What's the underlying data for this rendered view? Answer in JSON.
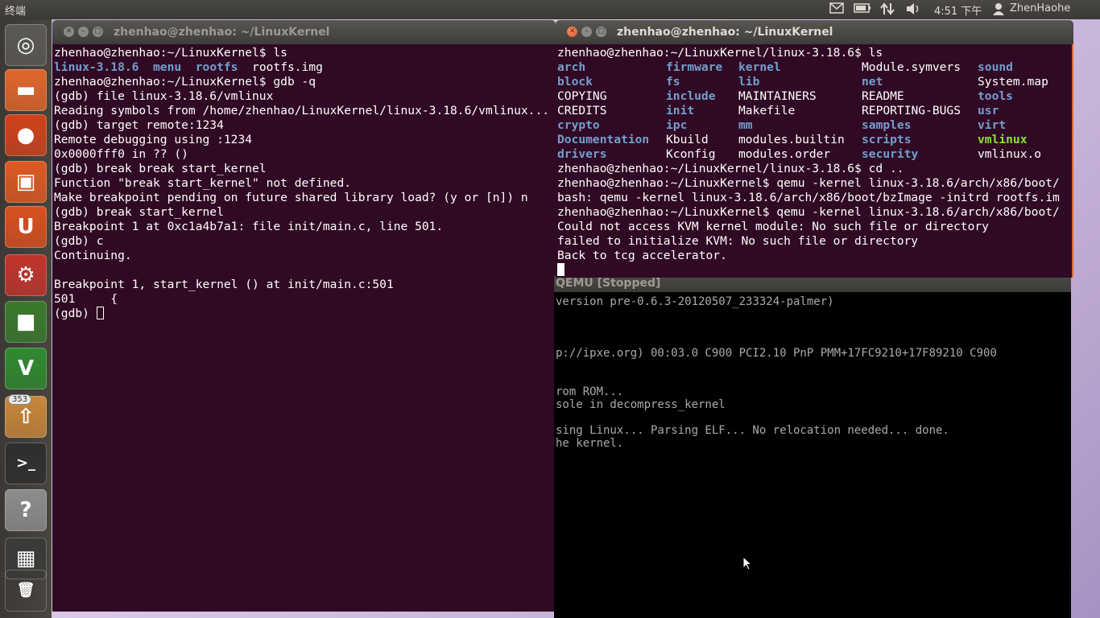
{
  "panel": {
    "app_title": "终端",
    "time": "4:51 下午",
    "user": "ZhenHaohe",
    "mail_icon": "mail-icon",
    "battery_icon": "battery-icon",
    "network_icon": "network-icon",
    "volume_icon": "volume-icon",
    "user_icon": "user-icon"
  },
  "launcher": {
    "items": [
      {
        "name": "dash-home",
        "icon": "ubuntu-logo-icon",
        "glyph": "◎",
        "color": "#5b5954"
      },
      {
        "name": "files",
        "icon": "folder-icon",
        "glyph": "▬",
        "color": "#e0662c"
      },
      {
        "name": "firefox",
        "icon": "firefox-icon",
        "glyph": "●",
        "color": "#d0421b"
      },
      {
        "name": "software-center",
        "icon": "shopping-bag-icon",
        "glyph": "▣",
        "color": "#dd5a22"
      },
      {
        "name": "ubuntu-one",
        "icon": "ubuntu-one-icon",
        "glyph": "U",
        "color": "#d9501e"
      },
      {
        "name": "system-settings",
        "icon": "settings-icon",
        "glyph": "⚙",
        "color": "#c2342c"
      },
      {
        "name": "workspaces",
        "icon": "workspaces-icon",
        "glyph": "■",
        "color": "#3a7a2c"
      },
      {
        "name": "vim",
        "icon": "vim-icon",
        "glyph": "V",
        "color": "#2f8a2f"
      },
      {
        "name": "update-manager",
        "icon": "update-icon",
        "glyph": "⇧",
        "color": "#c8873b"
      },
      {
        "name": "terminal",
        "icon": "terminal-icon",
        "glyph": ">_",
        "color": "#2e2e2e"
      },
      {
        "name": "help",
        "icon": "help-icon",
        "glyph": "?",
        "color": "#8d8d8d"
      },
      {
        "name": "workspace-switcher",
        "icon": "workspace-switcher-icon",
        "glyph": "▦",
        "color": "#3a3a38"
      },
      {
        "name": "trash",
        "icon": "trash-icon",
        "glyph": "🗑",
        "color": "#777"
      }
    ],
    "update_badge": "353"
  },
  "term_left": {
    "title": "zhenhao@zhenhao: ~/LinuxKernel",
    "lines": [
      "zhenhao@zhenhao:~/LinuxKernel$ ls",
      "",
      "zhenhao@zhenhao:~/LinuxKernel$ gdb -q",
      "(gdb) file linux-3.18.6/vmlinux",
      "Reading symbols from /home/zhenhao/LinuxKernel/linux-3.18.6/vmlinux...",
      "(gdb) target remote:1234",
      "Remote debugging using :1234",
      "0x0000fff0 in ?? ()",
      "(gdb) break break start_kernel",
      "Function \"break start_kernel\" not defined.",
      "Make breakpoint pending on future shared library load? (y or [n]) n",
      "(gdb) break start_kernel",
      "Breakpoint 1 at 0xc1a4b7a1: file init/main.c, line 501.",
      "(gdb) c",
      "Continuing.",
      "",
      "Breakpoint 1, start_kernel () at init/main.c:501",
      "501\t{",
      "(gdb) "
    ],
    "ls_output": [
      {
        "text": "linux-3.18.6",
        "kind": "dir"
      },
      {
        "text": "menu",
        "kind": "dir"
      },
      {
        "text": "rootfs",
        "kind": "dir"
      },
      {
        "text": "rootfs.img",
        "kind": "file"
      }
    ]
  },
  "term_right": {
    "title": "zhenhao@zhenhao: ~/LinuxKernel",
    "prompt_ls": "zhenhao@zhenhao:~/LinuxKernel/linux-3.18.6$ ls",
    "ls_rows": [
      [
        {
          "t": "arch",
          "k": "dir"
        },
        {
          "t": "firmware",
          "k": "dir"
        },
        {
          "t": "kernel",
          "k": "dir"
        },
        {
          "t": "Module.symvers",
          "k": "file"
        },
        {
          "t": "sound",
          "k": "dir"
        }
      ],
      [
        {
          "t": "block",
          "k": "dir"
        },
        {
          "t": "fs",
          "k": "dir"
        },
        {
          "t": "lib",
          "k": "dir"
        },
        {
          "t": "net",
          "k": "dir"
        },
        {
          "t": "System.map",
          "k": "file"
        }
      ],
      [
        {
          "t": "COPYING",
          "k": "file"
        },
        {
          "t": "include",
          "k": "dir"
        },
        {
          "t": "MAINTAINERS",
          "k": "file"
        },
        {
          "t": "README",
          "k": "file"
        },
        {
          "t": "tools",
          "k": "dir"
        }
      ],
      [
        {
          "t": "CREDITS",
          "k": "file"
        },
        {
          "t": "init",
          "k": "dir"
        },
        {
          "t": "Makefile",
          "k": "file"
        },
        {
          "t": "REPORTING-BUGS",
          "k": "file"
        },
        {
          "t": "usr",
          "k": "dir"
        }
      ],
      [
        {
          "t": "crypto",
          "k": "dir"
        },
        {
          "t": "ipc",
          "k": "dir"
        },
        {
          "t": "mm",
          "k": "dir"
        },
        {
          "t": "samples",
          "k": "dir"
        },
        {
          "t": "virt",
          "k": "dir"
        }
      ],
      [
        {
          "t": "Documentation",
          "k": "dir"
        },
        {
          "t": "Kbuild",
          "k": "file"
        },
        {
          "t": "modules.builtin",
          "k": "file"
        },
        {
          "t": "scripts",
          "k": "dir"
        },
        {
          "t": "vmlinux",
          "k": "exe"
        }
      ],
      [
        {
          "t": "drivers",
          "k": "dir"
        },
        {
          "t": "Kconfig",
          "k": "file"
        },
        {
          "t": "modules.order",
          "k": "file"
        },
        {
          "t": "security",
          "k": "dir"
        },
        {
          "t": "vmlinux.o",
          "k": "file"
        }
      ]
    ],
    "lines_after": [
      "zhenhao@zhenhao:~/LinuxKernel/linux-3.18.6$ cd ..",
      "zhenhao@zhenhao:~/LinuxKernel$ qemu -kernel linux-3.18.6/arch/x86/boot/",
      "bash: qemu -kernel linux-3.18.6/arch/x86/boot/bzImage -initrd rootfs.im",
      "zhenhao@zhenhao:~/LinuxKernel$ qemu -kernel linux-3.18.6/arch/x86/boot/",
      "Could not access KVM kernel module: No such file or directory",
      "failed to initialize KVM: No such file or directory",
      "Back to tcg accelerator."
    ]
  },
  "qemu": {
    "title": "QEMU [Stopped]",
    "lines": [
      {
        "text": "version pre-0.6.3-20120507_233324-palmer)",
        "row": 0
      },
      {
        "text": "p://ipxe.org) 00:03.0 C900 PCI2.10 PnP PMM+17FC9210+17F89210 C900",
        "row": 4
      },
      {
        "text": "rom ROM...",
        "row": 7
      },
      {
        "text": "sole in decompress_kernel",
        "row": 8
      },
      {
        "text": "sing Linux... Parsing ELF... No relocation needed... done.",
        "row": 10
      },
      {
        "text": "he kernel.",
        "row": 11
      }
    ]
  },
  "colors": {
    "terminal_bg": "#300a24",
    "dir": "#729fcf",
    "exe": "#8ae234",
    "close_button": "#df4a1c"
  }
}
